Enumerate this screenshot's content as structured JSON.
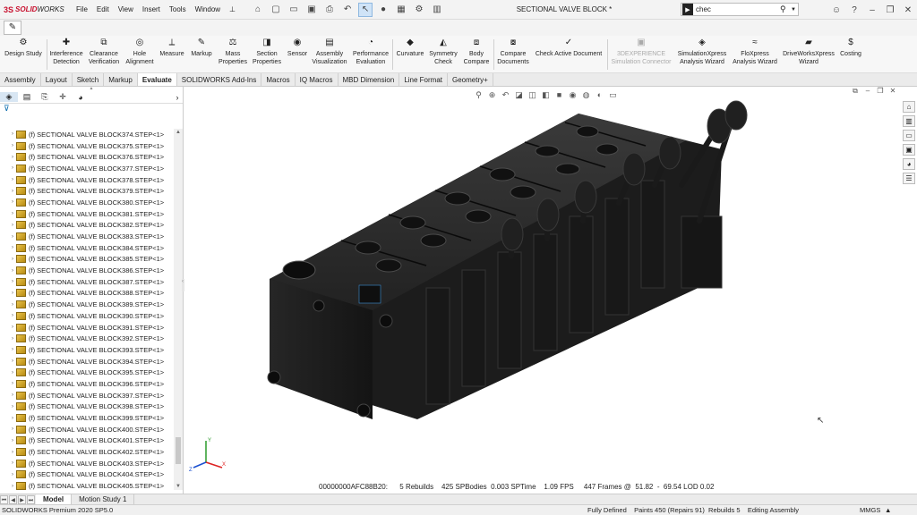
{
  "app": {
    "logo_ds": "3S",
    "logo_solid": "SOLID",
    "logo_works": "WORKS"
  },
  "menu": [
    "File",
    "Edit",
    "View",
    "Insert",
    "Tools",
    "Window"
  ],
  "window_title": "SECTIONAL VALVE BLOCK *",
  "search": {
    "value": "chec",
    "icon_label": "▶"
  },
  "ribbon": {
    "design_study": "Design Study",
    "interference": "Interference Detection",
    "clearance": "Clearance Verification",
    "hole": "Hole Alignment",
    "measure": "Measure",
    "markup": "Markup",
    "mass": "Mass Properties",
    "section": "Section Properties",
    "sensor": "Sensor",
    "assembly_vis": "Assembly Visualization",
    "performance": "Performance Evaluation",
    "curvature": "Curvature",
    "symmetry": "Symmetry Check",
    "body_compare": "Body Compare",
    "compare_docs": "Compare Documents",
    "check_active": "Check Active Document",
    "experience": "3DEXPERIENCE Simulation Connector",
    "simxpress": "SimulationXpress Analysis Wizard",
    "floxpress": "FloXpress Analysis Wizard",
    "driveworks": "DriveWorksXpress Wizard",
    "costing": "Costing"
  },
  "tabs": [
    "Assembly",
    "Layout",
    "Sketch",
    "Markup",
    "Evaluate",
    "SOLIDWORKS Add-Ins",
    "Macros",
    "IQ Macros",
    "MBD Dimension",
    "Line Format",
    "Geometry+"
  ],
  "active_tab": "Evaluate",
  "tree_items": [
    "(f) SECTIONAL VALVE BLOCK374.STEP<1>",
    "(f) SECTIONAL VALVE BLOCK375.STEP<1>",
    "(f) SECTIONAL VALVE BLOCK376.STEP<1>",
    "(f) SECTIONAL VALVE BLOCK377.STEP<1>",
    "(f) SECTIONAL VALVE BLOCK378.STEP<1>",
    "(f) SECTIONAL VALVE BLOCK379.STEP<1>",
    "(f) SECTIONAL VALVE BLOCK380.STEP<1>",
    "(f) SECTIONAL VALVE BLOCK381.STEP<1>",
    "(f) SECTIONAL VALVE BLOCK382.STEP<1>",
    "(f) SECTIONAL VALVE BLOCK383.STEP<1>",
    "(f) SECTIONAL VALVE BLOCK384.STEP<1>",
    "(f) SECTIONAL VALVE BLOCK385.STEP<1>",
    "(f) SECTIONAL VALVE BLOCK386.STEP<1>",
    "(f) SECTIONAL VALVE BLOCK387.STEP<1>",
    "(f) SECTIONAL VALVE BLOCK388.STEP<1>",
    "(f) SECTIONAL VALVE BLOCK389.STEP<1>",
    "(f) SECTIONAL VALVE BLOCK390.STEP<1>",
    "(f) SECTIONAL VALVE BLOCK391.STEP<1>",
    "(f) SECTIONAL VALVE BLOCK392.STEP<1>",
    "(f) SECTIONAL VALVE BLOCK393.STEP<1>",
    "(f) SECTIONAL VALVE BLOCK394.STEP<1>",
    "(f) SECTIONAL VALVE BLOCK395.STEP<1>",
    "(f) SECTIONAL VALVE BLOCK396.STEP<1>",
    "(f) SECTIONAL VALVE BLOCK397.STEP<1>",
    "(f) SECTIONAL VALVE BLOCK398.STEP<1>",
    "(f) SECTIONAL VALVE BLOCK399.STEP<1>",
    "(f) SECTIONAL VALVE BLOCK400.STEP<1>",
    "(f) SECTIONAL VALVE BLOCK401.STEP<1>",
    "(f) SECTIONAL VALVE BLOCK402.STEP<1>",
    "(f) SECTIONAL VALVE BLOCK403.STEP<1>",
    "(f) SECTIONAL VALVE BLOCK404.STEP<1>",
    "(f) SECTIONAL VALVE BLOCK405.STEP<1>"
  ],
  "viewport_status": "00000000AFC88B20:      5 Rebuilds    425 SPBodies  0.003 SPTime    1.09 FPS     447 Frames @  51.82  -  69.54 LOD 0.02",
  "triad": {
    "x": "X",
    "y": "Y",
    "z": "Z"
  },
  "bottom_tabs": [
    "Model",
    "Motion Study 1"
  ],
  "active_bottom_tab": "Model",
  "statusbar": {
    "product": "SOLIDWORKS Premium 2020 SP5.0",
    "right": "Fully Defined    Paints 450 (Repairs 91)  Rebuilds 5    Editing Assembly",
    "units": "MMGS"
  },
  "colors": {
    "accent": "#c8102e",
    "model_dark": "#1b1b1b",
    "model_face": "#2a2a2a"
  }
}
